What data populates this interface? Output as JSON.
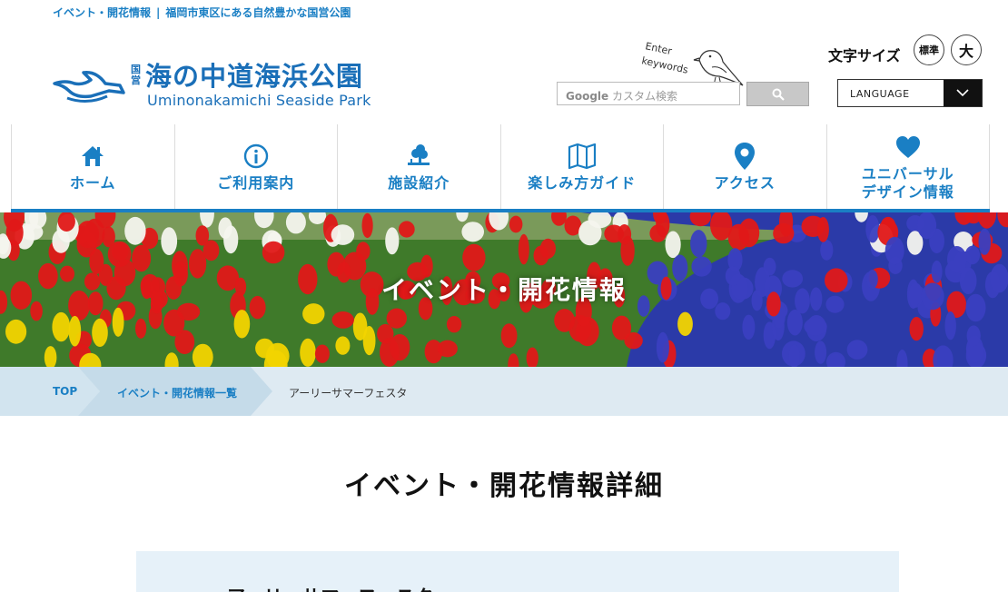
{
  "header": {
    "tagline_link": "イベント・開花情報",
    "tagline_sep": "|",
    "tagline_text": "福岡市東区にある自然豊かな国営公園",
    "logo_kokuei": "国営",
    "logo_title": "海の中道海浜公園",
    "logo_subtitle": "Uminonakamichi Seaside Park",
    "enter_text": "Enter keywords"
  },
  "search": {
    "brand": "Google",
    "placeholder": "カスタム検索"
  },
  "font_size": {
    "label": "文字サイズ",
    "standard": "標準",
    "large": "大"
  },
  "language": {
    "label": "LANGUAGE"
  },
  "nav": {
    "items": [
      {
        "label": "ホーム",
        "icon": "home-icon"
      },
      {
        "label": "ご利用案内",
        "icon": "info-icon"
      },
      {
        "label": "施設紹介",
        "icon": "tree-icon"
      },
      {
        "label": "楽しみ方ガイド",
        "icon": "map-icon"
      },
      {
        "label": "アクセス",
        "icon": "location-pin-icon"
      },
      {
        "label": "ユニバーサル",
        "label2": "デザイン情報",
        "icon": "heart-icon"
      }
    ]
  },
  "hero": {
    "title": "イベント・開花情報"
  },
  "breadcrumb": {
    "items": [
      "TOP",
      "イベント・開花情報一覧",
      "アーリーサマーフェスタ"
    ]
  },
  "main": {
    "page_title": "イベント・開花情報詳細",
    "event_title": "アーリーサマーフェスタ"
  },
  "colors": {
    "brand_blue": "#1a7fc4",
    "breadcrumb_bg": "#deeaf2",
    "content_bg": "#e6f1f9"
  }
}
